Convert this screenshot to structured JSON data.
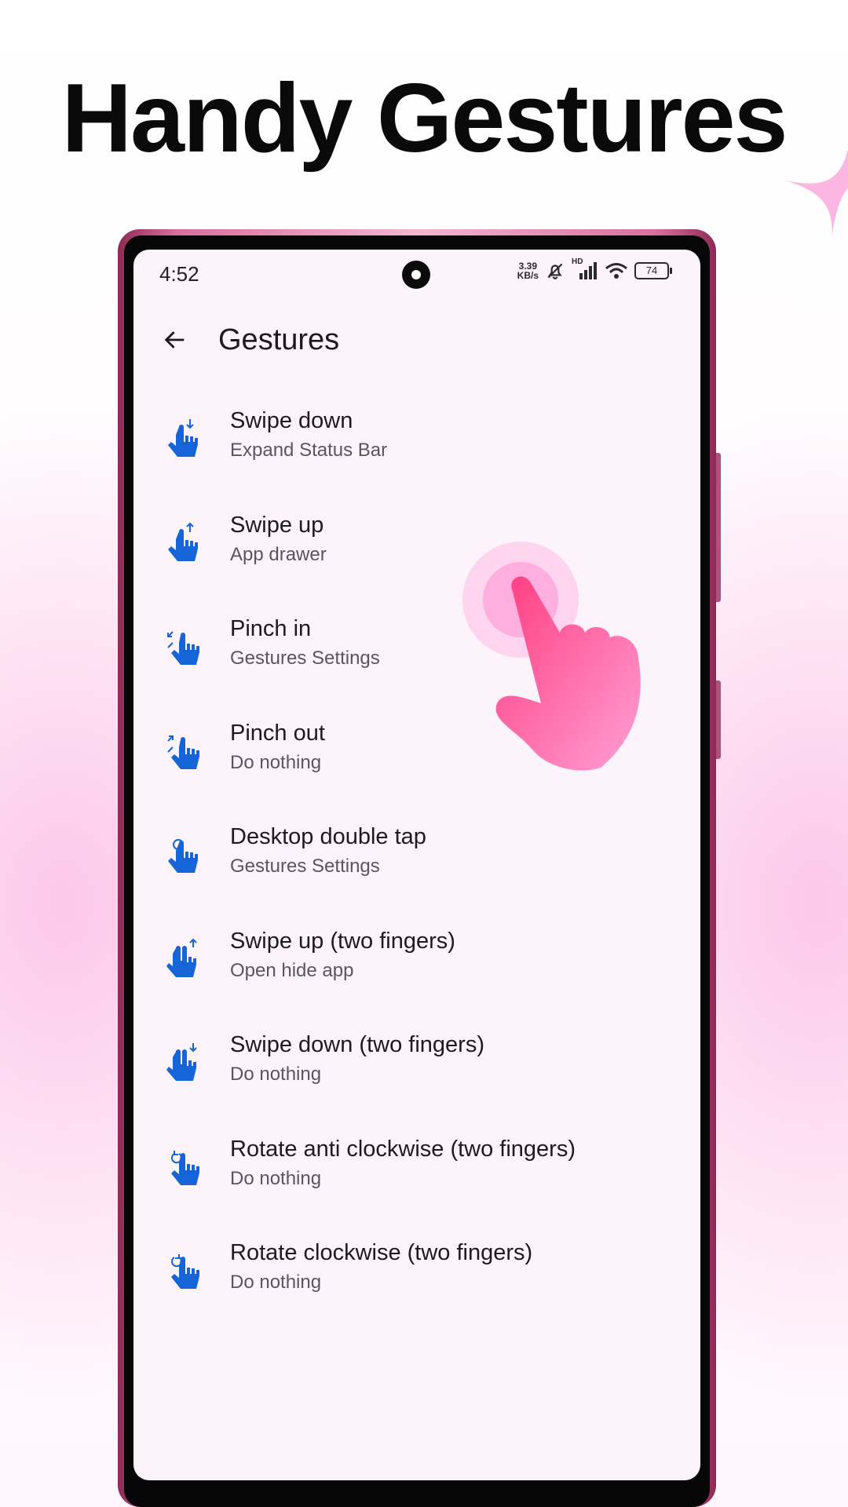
{
  "headline": "Handy Gestures",
  "status_bar": {
    "time": "4:52",
    "net_speed_value": "3.39",
    "net_speed_unit": "KB/s",
    "network_type": "HD",
    "battery": "74"
  },
  "app_bar": {
    "title": "Gestures"
  },
  "gestures": [
    {
      "title": "Swipe down",
      "subtitle": "Expand Status Bar",
      "icon": "swipe-down-icon"
    },
    {
      "title": "Swipe up",
      "subtitle": "App drawer",
      "icon": "swipe-up-icon"
    },
    {
      "title": "Pinch in",
      "subtitle": "Gestures Settings",
      "icon": "pinch-in-icon"
    },
    {
      "title": "Pinch out",
      "subtitle": "Do nothing",
      "icon": "pinch-out-icon"
    },
    {
      "title": "Desktop double tap",
      "subtitle": "Gestures Settings",
      "icon": "double-tap-icon"
    },
    {
      "title": "Swipe up (two fingers)",
      "subtitle": "Open hide app",
      "icon": "two-finger-swipe-up-icon"
    },
    {
      "title": "Swipe down (two fingers)",
      "subtitle": "Do nothing",
      "icon": "two-finger-swipe-down-icon"
    },
    {
      "title": "Rotate anti clockwise (two fingers)",
      "subtitle": "Do nothing",
      "icon": "rotate-anticlockwise-icon"
    },
    {
      "title": "Rotate clockwise (two fingers)",
      "subtitle": "Do nothing",
      "icon": "rotate-clockwise-icon"
    }
  ],
  "colors": {
    "icon_blue": "#1565d8",
    "accent_pink": "#ff4d8d"
  }
}
